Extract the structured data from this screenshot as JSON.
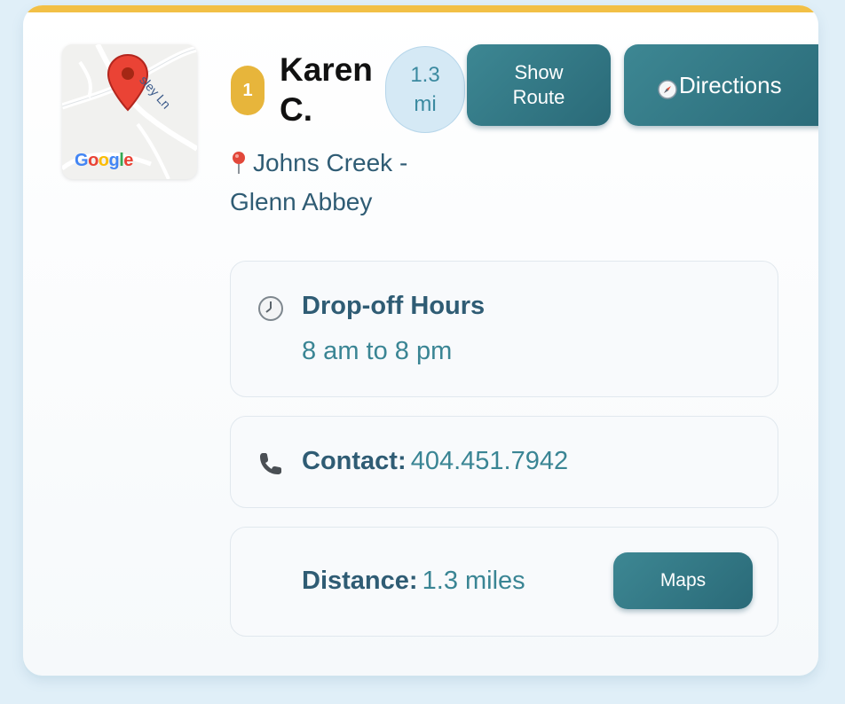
{
  "card": {
    "accent_color": "#f2c046",
    "button_color": "#2f7683"
  },
  "map_thumbnail": {
    "street_label": "sley Ln",
    "logo_text": "Google"
  },
  "listing": {
    "rank": "1",
    "name": "Karen C.",
    "distance_badge_value": "1.3",
    "distance_badge_unit": "mi",
    "location": "Johns Creek - Glenn Abbey"
  },
  "buttons": {
    "show_route_line1": "Show",
    "show_route_line2": "Route",
    "directions": "Directions",
    "maps": "Maps"
  },
  "hours": {
    "icon": "clock-icon",
    "label": "Drop-off Hours",
    "value": "8 am to 8 pm"
  },
  "contact": {
    "icon": "phone-icon",
    "label": "Contact:",
    "value": "404.451.7942"
  },
  "distance": {
    "label": "Distance:",
    "value": "1.3 miles"
  }
}
